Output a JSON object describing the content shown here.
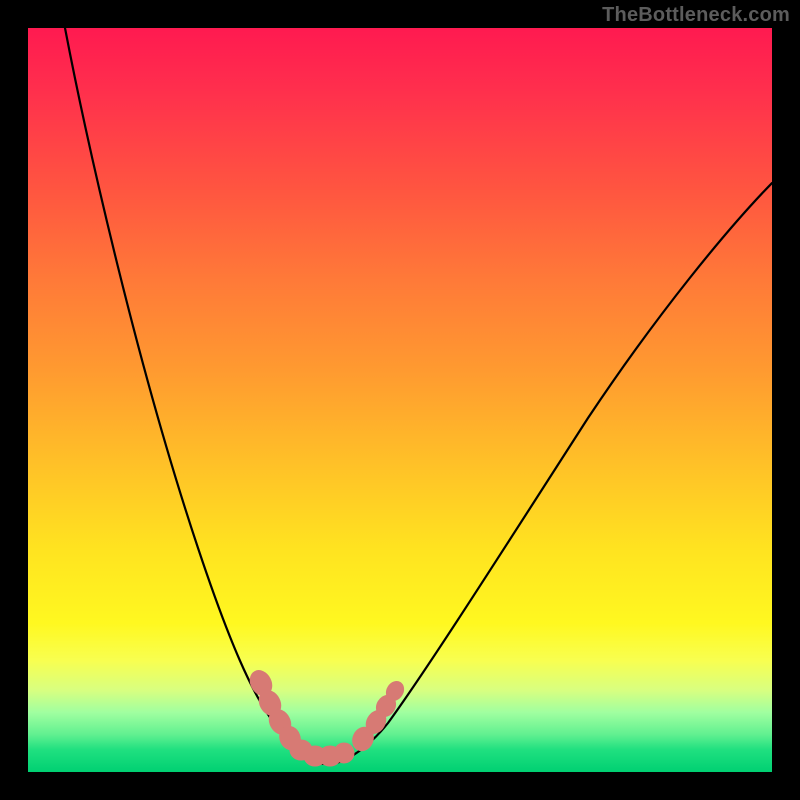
{
  "watermark": "TheBottleneck.com",
  "chart_data": {
    "type": "line",
    "title": "",
    "xlabel": "",
    "ylabel": "",
    "xlim": [
      0,
      100
    ],
    "ylim": [
      0,
      100
    ],
    "series": [
      {
        "name": "bottleneck-curve",
        "x": [
          5,
          10,
          15,
          20,
          25,
          28,
          30,
          32,
          34,
          36,
          38,
          40,
          42,
          45,
          50,
          55,
          60,
          65,
          70,
          75,
          80,
          85,
          90,
          95,
          100
        ],
        "values": [
          100,
          82,
          66,
          50,
          32,
          20,
          12,
          6,
          2,
          0,
          0,
          0,
          0,
          2,
          8,
          15,
          22,
          30,
          37,
          44,
          50,
          56,
          62,
          67,
          72
        ]
      }
    ],
    "markers": {
      "name": "highlighted-points",
      "color": "#d77a74",
      "points": [
        {
          "x": 30,
          "y": 12
        },
        {
          "x": 31,
          "y": 8
        },
        {
          "x": 32,
          "y": 5
        },
        {
          "x": 34,
          "y": 2
        },
        {
          "x": 36,
          "y": 0
        },
        {
          "x": 38,
          "y": 0
        },
        {
          "x": 40,
          "y": 0
        },
        {
          "x": 42,
          "y": 0
        },
        {
          "x": 44,
          "y": 2
        },
        {
          "x": 46,
          "y": 5
        },
        {
          "x": 47,
          "y": 7
        },
        {
          "x": 48,
          "y": 9
        }
      ]
    }
  }
}
